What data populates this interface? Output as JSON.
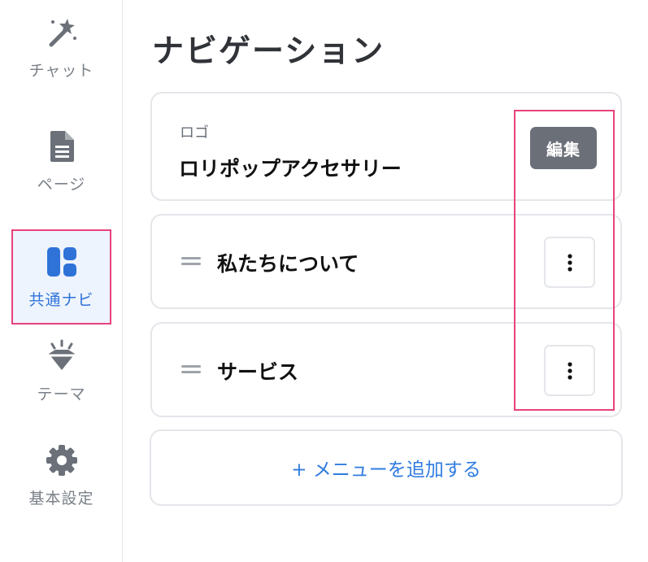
{
  "sidebar": {
    "items": [
      {
        "label": "チャット",
        "icon": "magic-wand-icon",
        "active": false
      },
      {
        "label": "ページ",
        "icon": "document-icon",
        "active": false
      },
      {
        "label": "共通ナビ",
        "icon": "layout-grid-icon",
        "active": true
      },
      {
        "label": "テーマ",
        "icon": "diamond-icon",
        "active": false
      },
      {
        "label": "基本設定",
        "icon": "gear-icon",
        "active": false
      }
    ]
  },
  "main": {
    "title": "ナビゲーション",
    "logo": {
      "caption": "ロゴ",
      "name": "ロリポップアクセサリー",
      "edit_label": "編集"
    },
    "menu_items": [
      {
        "label": "私たちについて",
        "icon": "drag-handle-icon",
        "action_icon": "more-vertical-icon"
      },
      {
        "label": "サービス",
        "icon": "drag-handle-icon",
        "action_icon": "more-vertical-icon"
      }
    ],
    "add_label": "+ メニューを追加する"
  },
  "colors": {
    "accent": "#2f73d8",
    "highlight": "#e8427c",
    "edit_button": "#6b6f78",
    "link": "#2f7be0"
  }
}
